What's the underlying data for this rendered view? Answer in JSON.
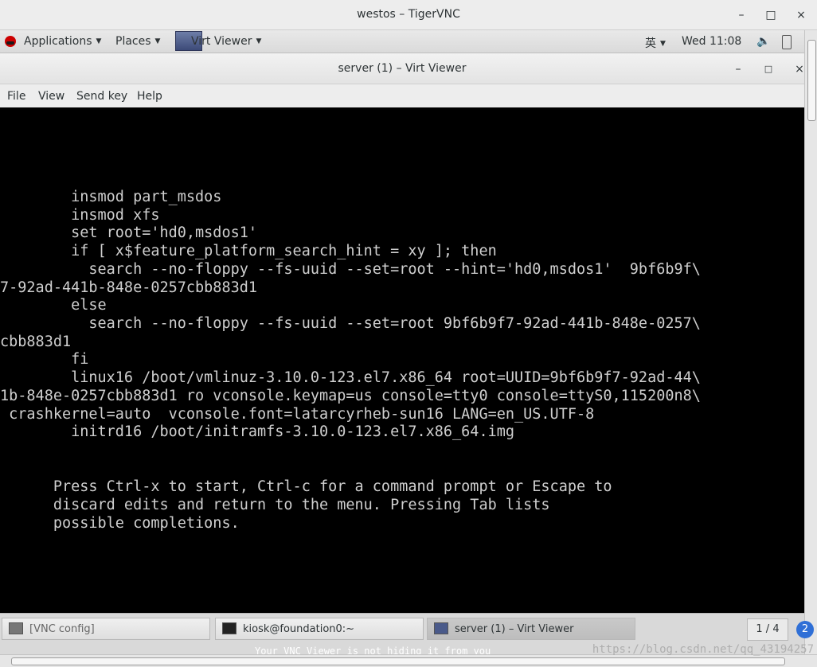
{
  "vnc": {
    "title": "westos – TigerVNC",
    "minimize": "–",
    "maximize": "□",
    "close": "×"
  },
  "panel": {
    "applications": "Applications",
    "places": "Places",
    "app_menu": "Virt Viewer",
    "input_method": "英",
    "clock": "Wed 11:08",
    "volume_icon": "speaker-icon",
    "battery_icon": "battery-icon",
    "power_icon": "power-icon"
  },
  "viewer": {
    "title": "server (1) – Virt Viewer",
    "minimize": "–",
    "maximize": "□",
    "close": "×",
    "menu": [
      "File",
      "View",
      "Send key",
      "Help"
    ]
  },
  "console": {
    "lines": [
      "        insmod part_msdos",
      "        insmod xfs",
      "        set root='hd0,msdos1'",
      "        if [ x$feature_platform_search_hint = xy ]; then",
      "          search --no-floppy --fs-uuid --set=root --hint='hd0,msdos1'  9bf6b9f\\",
      "7-92ad-441b-848e-0257cbb883d1",
      "        else",
      "          search --no-floppy --fs-uuid --set=root 9bf6b9f7-92ad-441b-848e-0257\\",
      "cbb883d1",
      "        fi",
      "        linux16 /boot/vmlinuz-3.10.0-123.el7.x86_64 root=UUID=9bf6b9f7-92ad-44\\",
      "1b-848e-0257cbb883d1 ro vconsole.keymap=us console=tty0 console=ttyS0,115200n8\\",
      " crashkernel=auto  vconsole.font=latarcyrheb-sun16 LANG=en_US.UTF-8",
      "        initrd16 /boot/initramfs-3.10.0-123.el7.x86_64.img"
    ],
    "help": [
      "      Press Ctrl-x to start, Ctrl-c for a command prompt or Escape to",
      "      discard edits and return to the menu. Pressing Tab lists",
      "      possible completions."
    ]
  },
  "taskbar": {
    "tasks": [
      "[VNC config]",
      "kiosk@foundation0:~",
      "server (1) – Virt Viewer"
    ],
    "workspace": "1 / 4",
    "notification_count": "2",
    "notice": "Your VNC Viewer is not hiding it from you"
  },
  "watermark": "https://blog.csdn.net/qq_43194257"
}
